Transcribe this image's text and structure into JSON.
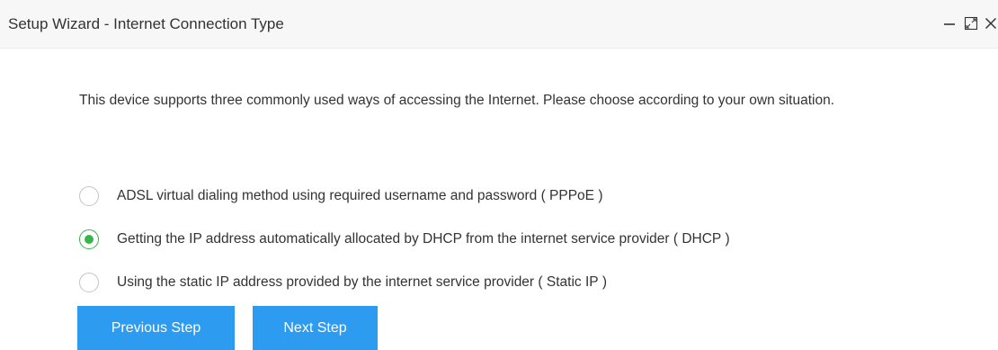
{
  "window": {
    "title": "Setup Wizard - Internet Connection Type",
    "controls": {
      "minimize_icon": "minimize-icon",
      "maximize_icon": "maximize-icon",
      "close_icon": "close-icon"
    }
  },
  "content": {
    "description": "This device supports three commonly used ways of accessing the Internet. Please choose according to your own situation."
  },
  "options": [
    {
      "label": "ADSL virtual dialing method using required username and password ( PPPoE )",
      "selected": false
    },
    {
      "label": "Getting the IP address automatically allocated by DHCP from the internet service provider ( DHCP )",
      "selected": true
    },
    {
      "label": "Using the static IP address provided by the internet service provider ( Static IP )",
      "selected": false
    }
  ],
  "buttons": {
    "previous": "Previous Step",
    "next": "Next Step"
  },
  "colors": {
    "accent_green": "#38b549",
    "button_blue": "#2d9bf0",
    "titlebar_bg": "#f7f7f7",
    "text": "#333333"
  }
}
